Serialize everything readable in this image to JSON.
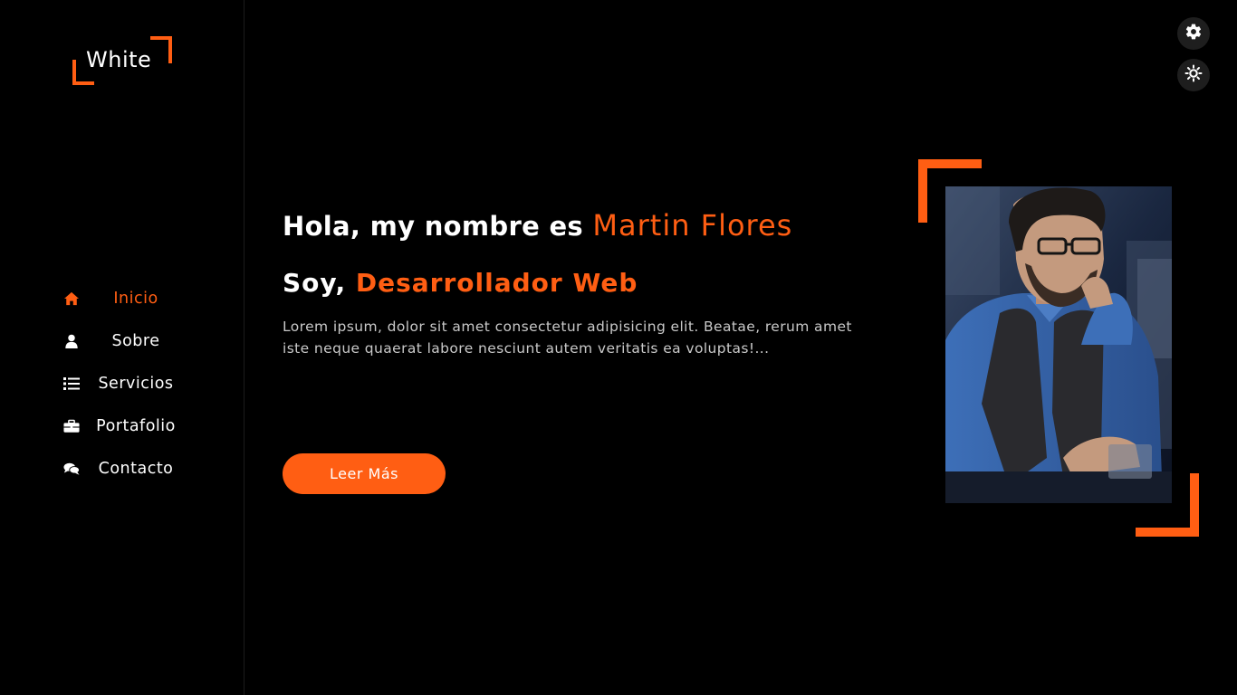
{
  "brand": {
    "name": "White"
  },
  "sidebar": {
    "items": [
      {
        "label": "Inicio",
        "icon": "home-icon",
        "active": true
      },
      {
        "label": "Sobre",
        "icon": "user-icon",
        "active": false
      },
      {
        "label": "Servicios",
        "icon": "list-icon",
        "active": false
      },
      {
        "label": "Portafolio",
        "icon": "briefcase-icon",
        "active": false
      },
      {
        "label": "Contacto",
        "icon": "comments-icon",
        "active": false
      }
    ]
  },
  "toolbar": {
    "settings_icon": "gear-icon",
    "theme_icon": "sun-icon"
  },
  "hero": {
    "greeting": "Hola, my nombre es",
    "name": "Martin Flores",
    "role_prefix": "Soy,",
    "role": "Desarrollador Web",
    "description": "Lorem ipsum, dolor sit amet consectetur adipisicing elit. Beatae, rerum amet iste neque quaerat labore nesciunt autem veritatis ea voluptas!...",
    "cta_label": "Leer Más"
  },
  "colors": {
    "accent": "#ff5e13",
    "background": "#000000",
    "text": "#ffffff"
  }
}
